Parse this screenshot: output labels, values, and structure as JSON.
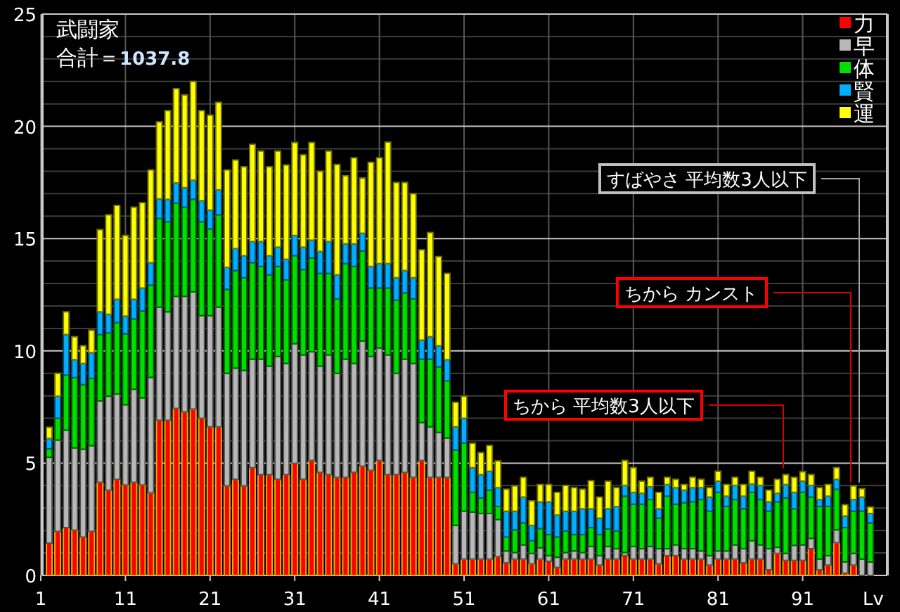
{
  "chart": {
    "summary": {
      "label": "合計＝",
      "value": "1037.8"
    },
    "callouts": [
      {
        "text": "すばやさ 平均数3人以下",
        "color": "#c0c0c0"
      },
      {
        "text": "ちから カンスト",
        "color": "#ff0000"
      },
      {
        "text": "ちから 平均数3人以下",
        "color": "#ff0000"
      }
    ],
    "chart_data": {
      "type": "bar",
      "stacked": true,
      "grid": true,
      "legend": true,
      "title": "武闘家",
      "xlabel": "Lv",
      "xlim": [
        1,
        101
      ],
      "ylim": [
        0,
        25
      ],
      "yticks": [
        0,
        5,
        10,
        15,
        20,
        25
      ],
      "xticks": [
        1,
        11,
        21,
        31,
        41,
        51,
        61,
        71,
        81,
        91
      ],
      "x": [
        2,
        3,
        4,
        5,
        6,
        7,
        8,
        9,
        10,
        11,
        12,
        13,
        14,
        15,
        16,
        17,
        18,
        19,
        20,
        21,
        22,
        23,
        24,
        25,
        26,
        27,
        28,
        29,
        30,
        31,
        32,
        33,
        34,
        35,
        36,
        37,
        38,
        39,
        40,
        41,
        42,
        43,
        44,
        45,
        46,
        47,
        48,
        49,
        50,
        51,
        52,
        53,
        54,
        55,
        56,
        57,
        58,
        59,
        60,
        61,
        62,
        63,
        64,
        65,
        66,
        67,
        68,
        69,
        70,
        71,
        72,
        73,
        74,
        75,
        76,
        77,
        78,
        79,
        80,
        81,
        82,
        83,
        84,
        85,
        86,
        87,
        88,
        89,
        90,
        91,
        92,
        93,
        94,
        95,
        96,
        97,
        98,
        99
      ],
      "series": [
        {
          "name": "力",
          "color": "#ff0000",
          "values": [
            1.44,
            1.96,
            2.13,
            2.02,
            1.71,
            1.96,
            4.15,
            3.8,
            4.28,
            4.03,
            4.15,
            4.03,
            3.68,
            6.91,
            6.91,
            7.44,
            7.29,
            7.41,
            7.0,
            6.62,
            6.62,
            3.99,
            4.28,
            3.99,
            4.8,
            4.49,
            4.49,
            4.28,
            4.49,
            4.99,
            4.28,
            5.12,
            4.59,
            4.49,
            4.37,
            4.37,
            4.59,
            4.87,
            4.68,
            5.12,
            4.49,
            4.49,
            4.59,
            4.37,
            5.12,
            4.37,
            4.37,
            4.37,
            0.52,
            0.73,
            0.73,
            0.73,
            0.73,
            0.84,
            0.56,
            0.73,
            0.73,
            0.52,
            0.73,
            0.63,
            0.36,
            0.73,
            0.73,
            0.73,
            0.73,
            0.46,
            0.73,
            0.73,
            0.88,
            0.73,
            0.73,
            0.73,
            0.52,
            0.88,
            0.88,
            0.73,
            0.73,
            0.73,
            0.46,
            0.73,
            0.73,
            0.73,
            0.56,
            0.73,
            0.73,
            0.25,
            0.98,
            0.67,
            0.67,
            0.67,
            1.19,
            0.25,
            0.46,
            1.46,
            0.1,
            0.46,
            0,
            0
          ]
        },
        {
          "name": "早",
          "color": "#b8b8b8",
          "values": [
            3.82,
            4.07,
            4.34,
            3.66,
            3.91,
            3.82,
            3.62,
            4.18,
            3.8,
            3.57,
            4.14,
            3.88,
            5.14,
            5.04,
            4.83,
            4.99,
            5.14,
            5.22,
            4.57,
            4.95,
            5.33,
            5.01,
            4.95,
            5.14,
            4.83,
            5.14,
            4.83,
            5.47,
            4.95,
            5.33,
            5.54,
            4.84,
            4.73,
            5.33,
            4.63,
            5.26,
            4.85,
            5.57,
            5.07,
            5.01,
            5.33,
            4.51,
            5.04,
            5.07,
            1.69,
            2.25,
            2.0,
            1.75,
            1.71,
            2.13,
            2.09,
            2.03,
            2.03,
            1.65,
            0.53,
            0.29,
            0.63,
            0.46,
            0.5,
            0.25,
            0.45,
            0.29,
            0.36,
            0.29,
            0.56,
            0.42,
            0.56,
            0.46,
            0.14,
            0.56,
            0.46,
            0.56,
            0.67,
            0.31,
            0.48,
            0.46,
            0.46,
            0.36,
            0.42,
            0.36,
            0.36,
            0.63,
            0.63,
            0.82,
            0.63,
            0.94,
            0.27,
            0.31,
            0.67,
            0.69,
            0.46,
            0.48,
            0.42,
            0.57,
            0.5,
            0.52,
            0.73,
            0.6
          ]
        },
        {
          "name": "体",
          "color": "#00e000",
          "values": [
            0.38,
            0.97,
            2.45,
            3.13,
            2.88,
            2.99,
            2.96,
            2.82,
            3.18,
            3.16,
            3.13,
            3.87,
            4.11,
            3.94,
            4.01,
            4.15,
            3.97,
            4.12,
            4.18,
            3.86,
            4.11,
            3.74,
            4.35,
            4.13,
            4.3,
            4.13,
            4.07,
            4.01,
            3.72,
            3.92,
            3.8,
            4.18,
            4.13,
            3.63,
            3.32,
            4.26,
            4.32,
            4.01,
            3.05,
            2.67,
            2.98,
            3.26,
            2.95,
            2.88,
            2.82,
            3.01,
            2.92,
            2.55,
            3.35,
            3.03,
            0.88,
            0.69,
            1.04,
            0.58,
            0.62,
            1.01,
            0.98,
            0.57,
            0.86,
            0.94,
            0.9,
            0.96,
            0.73,
            0.8,
            0.84,
            0.94,
            0.78,
            0.79,
            2.51,
            1.88,
            1.98,
            2.09,
            1.36,
            2.34,
            1.81,
            2.05,
            2.09,
            2.29,
            1.98,
            2.61,
            1.98,
            2.02,
            1.78,
            2.15,
            2.02,
            1.67,
            2.03,
            2.47,
            1.63,
            2.34,
            1.84,
            2.34,
            2.19,
            1.81,
            1.53,
            1.88,
            2.13,
            1.74
          ]
        },
        {
          "name": "賢",
          "color": "#00b0ff",
          "values": [
            0.46,
            0.98,
            1.81,
            0.8,
            0.94,
            1.15,
            1.01,
            0.83,
            1.04,
            0.79,
            0.88,
            1.02,
            1.0,
            0.88,
            1.0,
            0.9,
            0.87,
            0.85,
            0.94,
            0.84,
            1.11,
            0.98,
            0.98,
            0.98,
            0.94,
            1.11,
            0.85,
            0.86,
            0.92,
            0.9,
            1.0,
            0.79,
            0.98,
            1.42,
            1.07,
            0.88,
            1.01,
            0.79,
            0.96,
            1.09,
            1.09,
            1.0,
            1.0,
            0.94,
            0.85,
            1.0,
            0.94,
            0.94,
            1.04,
            1.11,
            1.1,
            1.04,
            0.84,
            0.84,
            1.15,
            0.83,
            1.15,
            0.68,
            1.19,
            1.46,
            0.98,
            0.88,
            1.04,
            1.15,
            0.84,
            0.73,
            0.9,
            1.09,
            0.48,
            0.53,
            0.49,
            0.57,
            0.42,
            0.52,
            0.74,
            0.56,
            0.63,
            0.53,
            0.63,
            0.5,
            0.46,
            0.63,
            0.56,
            0.37,
            0.63,
            0.42,
            0.38,
            0.6,
            0.73,
            0.5,
            0.52,
            0.31,
            0.46,
            0.44,
            0.52,
            0.52,
            0.63,
            0.42
          ]
        },
        {
          "name": "運",
          "color": "#ffff00",
          "values": [
            0.5,
            1.02,
            1.01,
            1.02,
            0.79,
            1.0,
            3.66,
            4.43,
            4.18,
            3.59,
            4.1,
            3.8,
            4.13,
            3.43,
            3.95,
            4.2,
            4.13,
            4.4,
            4.01,
            4.23,
            3.9,
            4.34,
            3.94,
            3.96,
            4.33,
            4.03,
            3.96,
            4.28,
            4.2,
            4.14,
            4.11,
            4.35,
            3.57,
            4.03,
            4.91,
            3.03,
            3.83,
            2.46,
            4.64,
            4.71,
            5.41,
            4.24,
            3.92,
            3.74,
            4.02,
            4.64,
            3.97,
            3.84,
            1.09,
            0.98,
            1.09,
            0.98,
            1.15,
            1.19,
            0.98,
            1.13,
            0.88,
            1.09,
            0.77,
            0.77,
            1.01,
            1.15,
            1.05,
            0.87,
            1.25,
            0.94,
            1.23,
            0.84,
            1.11,
            1.1,
            0.54,
            0.42,
            0.73,
            0.32,
            0.37,
            0.25,
            0.46,
            0.37,
            0.42,
            0.44,
            0.52,
            0.36,
            0.52,
            0.57,
            0.36,
            0.52,
            0.62,
            0.44,
            0.67,
            0.42,
            0.48,
            0.53,
            0.52,
            0.52,
            0.5,
            0.61,
            0.37,
            0.29
          ]
        }
      ]
    }
  }
}
